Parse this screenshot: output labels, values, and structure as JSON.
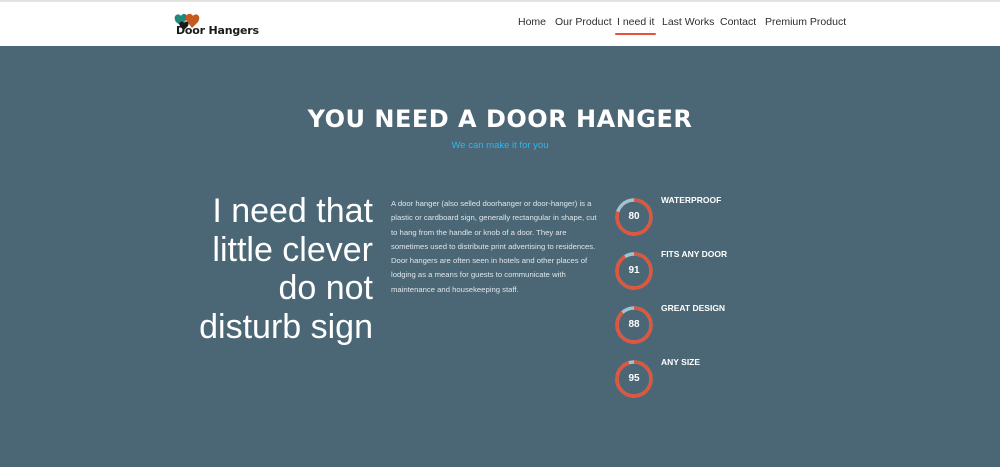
{
  "colors": {
    "hero_bg": "#4b6775",
    "accent": "#e0553c",
    "subtitle": "#35b3ec",
    "ring_track": "#9fc3d0"
  },
  "header": {
    "logo_text": "Door Hangers",
    "nav": [
      {
        "label": "Home",
        "active": false
      },
      {
        "label": "Our Product",
        "active": false
      },
      {
        "label": "I need it",
        "active": true
      },
      {
        "label": "Last Works",
        "active": false
      },
      {
        "label": "Contact",
        "active": false
      },
      {
        "label": "Premium Product",
        "active": false
      }
    ]
  },
  "section": {
    "title": "YOU NEED A DOOR HANGER",
    "subtitle": "We can make it for you",
    "quote_lines": [
      "I need that",
      "little clever",
      "do not",
      "disturb sign"
    ],
    "description": "A door hanger (also selled doorhanger or door-hanger) is a plastic or cardboard sign, generally rectangular in shape, cut to hang from the handle or knob of a door. They are sometimes used to distribute print advertising to residences. Door hangers are often seen in hotels and other places of lodging as a means for guests to communicate with maintenance and housekeeping staff."
  },
  "skills": [
    {
      "label": "WATERPROOF",
      "value": 80
    },
    {
      "label": "FITS ANY DOOR",
      "value": 91
    },
    {
      "label": "GREAT DESIGN",
      "value": 88
    },
    {
      "label": "ANY SIZE",
      "value": 95
    }
  ]
}
